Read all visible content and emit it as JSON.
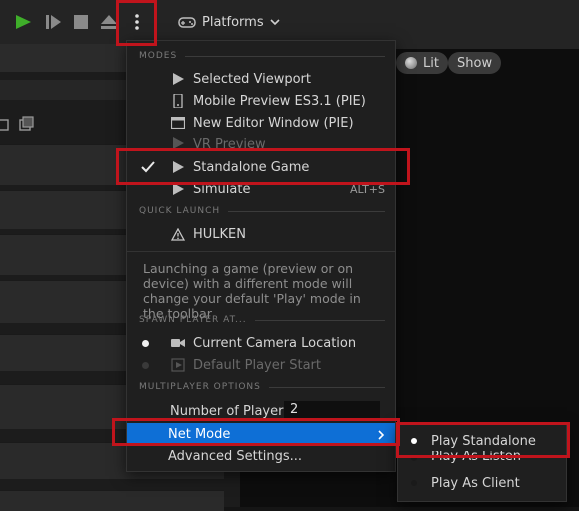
{
  "toolbar": {
    "platforms_label": "Platforms"
  },
  "viewport": {
    "lit_label": "Lit",
    "show_label": "Show"
  },
  "menu": {
    "modes_header": "MODES",
    "modes": [
      {
        "label": "Selected Viewport",
        "enabled": true
      },
      {
        "label": "Mobile Preview ES3.1 (PIE)",
        "enabled": true
      },
      {
        "label": "New Editor Window (PIE)",
        "enabled": true
      },
      {
        "label": "VR Preview",
        "enabled": false
      },
      {
        "label": "Standalone Game",
        "enabled": true,
        "checked": true
      },
      {
        "label": "Simulate",
        "enabled": true,
        "shortcut": "ALT+S"
      }
    ],
    "quick_launch_header": "QUICK LAUNCH",
    "quick_launch_item": "HULKEN",
    "note": "Launching a game (preview or on device) with a different mode will change your default 'Play' mode in the toolbar",
    "spawn_header": "SPAWN PLAYER AT...",
    "spawn_items": [
      {
        "label": "Current Camera Location",
        "selected": true
      },
      {
        "label": "Default Player Start",
        "selected": false
      }
    ],
    "multiplayer_header": "MULTIPLAYER OPTIONS",
    "num_players_label": "Number of Players",
    "num_players_value": "2",
    "net_mode_label": "Net Mode",
    "advanced_label": "Advanced Settings..."
  },
  "submenu": {
    "items": [
      {
        "label": "Play Standalone",
        "selected": true
      },
      {
        "label": "Play As Listen Server",
        "selected": false
      },
      {
        "label": "Play As Client",
        "selected": false
      }
    ]
  },
  "colors": {
    "highlight": "#0e6fd6",
    "annotation": "#c0141c",
    "play_green": "#3fae2a"
  }
}
